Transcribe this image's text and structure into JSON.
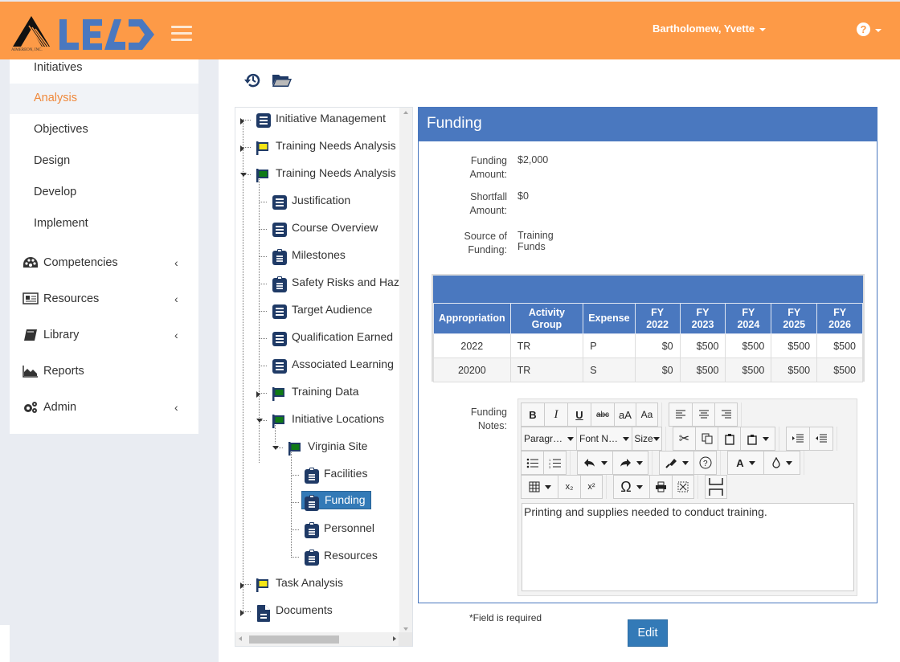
{
  "header": {
    "logo_company": "AIMEREON, INC.",
    "app_name": "LEAD",
    "user_name": "Bartholomew, Yvette",
    "help_label": "?"
  },
  "colors": {
    "header_bg": "#fd9a47",
    "primary_blue": "#4a78bf",
    "active_nav": "#f0883a",
    "button_blue": "#337ab7",
    "tree_icon_navy": "#1f3a66",
    "flag_yellow": "#f5e616",
    "flag_green": "#0f7a16"
  },
  "sidebar": {
    "items": [
      {
        "label": "Initiatives",
        "active": false
      },
      {
        "label": "Analysis",
        "active": true
      },
      {
        "label": "Objectives",
        "active": false
      },
      {
        "label": "Design",
        "active": false
      },
      {
        "label": "Develop",
        "active": false
      },
      {
        "label": "Implement",
        "active": false
      }
    ],
    "groups": [
      {
        "label": "Competencies",
        "icon": "dashboard-icon",
        "chevron": "‹"
      },
      {
        "label": "Resources",
        "icon": "newspaper-icon",
        "chevron": "‹"
      },
      {
        "label": "Library",
        "icon": "book-icon",
        "chevron": "‹"
      },
      {
        "label": "Reports",
        "icon": "area-chart-icon",
        "chevron": ""
      },
      {
        "label": "Admin",
        "icon": "gears-icon",
        "chevron": "‹"
      }
    ]
  },
  "toolbar": {
    "history_icon": "history-icon",
    "folder_icon": "folder-open-icon"
  },
  "tree": {
    "nodes": [
      {
        "label": "Initiative Management",
        "icon": "doc-list",
        "level": 0,
        "expander": "right"
      },
      {
        "label": "Training Needs Analysis",
        "icon": "flag-yellow",
        "level": 0,
        "expander": "right"
      },
      {
        "label": "Training Needs Analysis",
        "icon": "flag-green",
        "level": 0,
        "expander": "down"
      },
      {
        "label": "Justification",
        "icon": "doc-list",
        "level": 1,
        "expander": ""
      },
      {
        "label": "Course Overview",
        "icon": "doc-list",
        "level": 1,
        "expander": ""
      },
      {
        "label": "Milestones",
        "icon": "clipboard",
        "level": 1,
        "expander": ""
      },
      {
        "label": "Safety Risks and Haz",
        "icon": "clipboard",
        "level": 1,
        "expander": ""
      },
      {
        "label": "Target Audience",
        "icon": "doc-list",
        "level": 1,
        "expander": ""
      },
      {
        "label": "Qualification Earned",
        "icon": "doc-list",
        "level": 1,
        "expander": ""
      },
      {
        "label": "Associated Learning",
        "icon": "doc-list",
        "level": 1,
        "expander": ""
      },
      {
        "label": "Training Data",
        "icon": "flag-green",
        "level": 1,
        "expander": "right"
      },
      {
        "label": "Initiative Locations",
        "icon": "flag-green",
        "level": 1,
        "expander": "down"
      },
      {
        "label": "Virginia Site",
        "icon": "flag-green",
        "level": 2,
        "expander": "down"
      },
      {
        "label": "Facilities",
        "icon": "clipboard",
        "level": 3,
        "expander": ""
      },
      {
        "label": "Funding",
        "icon": "clipboard",
        "level": 3,
        "expander": "",
        "selected": true
      },
      {
        "label": "Personnel",
        "icon": "clipboard",
        "level": 3,
        "expander": ""
      },
      {
        "label": "Resources",
        "icon": "clipboard",
        "level": 3,
        "expander": ""
      },
      {
        "label": "Task Analysis",
        "icon": "flag-yellow",
        "level": 0,
        "expander": "right"
      },
      {
        "label": "Documents",
        "icon": "file",
        "level": 0,
        "expander": "right"
      }
    ]
  },
  "panel": {
    "title": "Funding",
    "fields": [
      {
        "label_line1": "Funding",
        "label_line2": "Amount:",
        "value": "$2,000"
      },
      {
        "label_line1": "Shortfall",
        "label_line2": "Amount:",
        "value": "$0"
      },
      {
        "label_line1": "Source of",
        "label_line2": "Funding:",
        "value": "Training Funds"
      }
    ],
    "table": {
      "columns": [
        "Appropriation",
        "Activity Group",
        "Expense",
        "FY 2022",
        "FY 2023",
        "FY 2024",
        "FY 2025",
        "FY 2026"
      ],
      "rows": [
        [
          "2022",
          "TR",
          "P",
          "$0",
          "$500",
          "$500",
          "$500",
          "$500"
        ],
        [
          "20200",
          "TR",
          "S",
          "$0",
          "$500",
          "$500",
          "$500",
          "$500"
        ]
      ]
    },
    "notes": {
      "label_line1": "Funding",
      "label_line2": "Notes:",
      "content": "Printing and supplies needed to conduct training.",
      "toolbar": {
        "bold": "B",
        "italic": "I",
        "underline": "U",
        "strike": "abc",
        "lowercase": "aA",
        "titlecase": "Aa",
        "paragraph": "Paragr…",
        "font_name": "Font N…",
        "size": "Size",
        "special_char": "Ω",
        "subscript": "x₂",
        "superscript": "x²"
      }
    }
  },
  "footer": {
    "required_note": "*Field is required",
    "edit_label": "Edit"
  }
}
